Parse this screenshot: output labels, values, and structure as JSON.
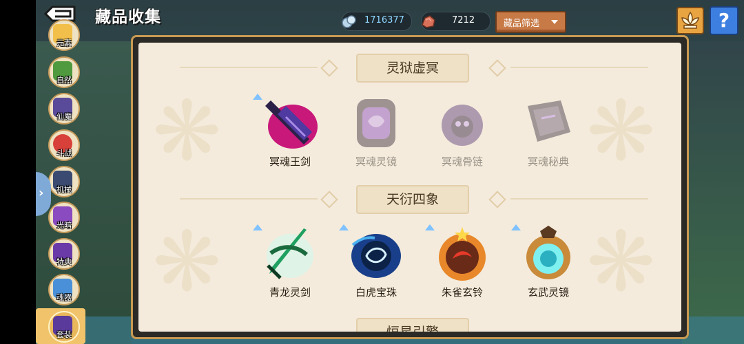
{
  "header": {
    "title": "藏品收集",
    "resources": [
      {
        "icon": "crystal-icon",
        "value": "1716377"
      },
      {
        "icon": "ore-icon",
        "value": "7212"
      }
    ],
    "filter_label": "藏品筛选",
    "help_label": "?"
  },
  "sidebar": {
    "items": [
      {
        "label": "元素",
        "icon": "element-icon"
      },
      {
        "label": "自然",
        "icon": "nature-icon"
      },
      {
        "label": "仙魔",
        "icon": "immortal-demon-icon"
      },
      {
        "label": "斗战",
        "icon": "battle-icon"
      },
      {
        "label": "机械",
        "icon": "mech-icon"
      },
      {
        "label": "光暗",
        "icon": "light-dark-icon"
      },
      {
        "label": "特典",
        "icon": "special-icon"
      },
      {
        "label": "魂器",
        "icon": "soul-vessel-icon"
      },
      {
        "label": "套装",
        "icon": "set-icon",
        "active": true
      }
    ]
  },
  "sections": [
    {
      "title": "灵狱虚冥",
      "items": [
        {
          "name": "冥魂王剑",
          "locked": false,
          "upgradable": true
        },
        {
          "name": "冥魂灵镜",
          "locked": true,
          "upgradable": false
        },
        {
          "name": "冥魂骨链",
          "locked": true,
          "upgradable": false
        },
        {
          "name": "冥魂秘典",
          "locked": true,
          "upgradable": false
        }
      ]
    },
    {
      "title": "天衍四象",
      "items": [
        {
          "name": "青龙灵剑",
          "locked": false,
          "upgradable": true
        },
        {
          "name": "白虎宝珠",
          "locked": false,
          "upgradable": true
        },
        {
          "name": "朱雀玄铃",
          "locked": false,
          "upgradable": true
        },
        {
          "name": "玄武灵镜",
          "locked": false,
          "upgradable": true
        }
      ]
    },
    {
      "title": "恒星引擎",
      "items": []
    }
  ],
  "colors": {
    "panel_bg": "#f4ebdc",
    "panel_border": "#c99a52",
    "filter_button": "#c77a46",
    "help_button": "#3c7fe0",
    "crystal_text": "#8fd6ff"
  }
}
